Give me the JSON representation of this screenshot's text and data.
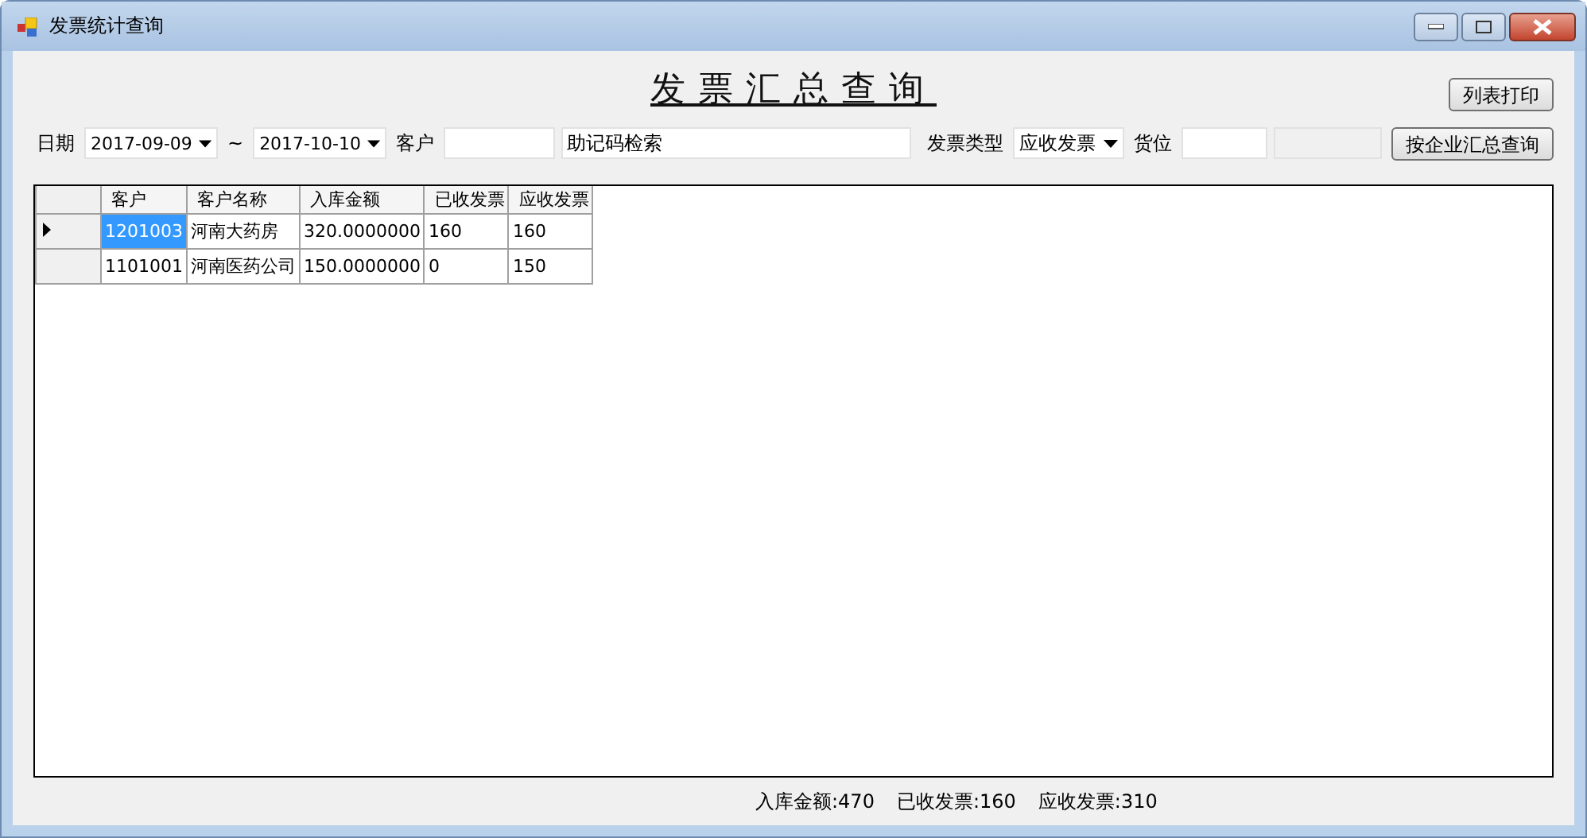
{
  "window": {
    "title": "发票统计查询"
  },
  "heading": "发票汇总查询",
  "print_button": "列表打印",
  "filters": {
    "date_label": "日期",
    "date_from": "2017-09-09",
    "range_sep": "~",
    "date_to": "2017-10-10",
    "customer_label": "客户",
    "mnemonic_search": "助记码检索",
    "invoice_type_label": "发票类型",
    "invoice_type": "应收发票",
    "location_label": "货位",
    "query_button": "按企业汇总查询"
  },
  "table": {
    "columns": [
      "客户",
      "客户名称",
      "入库金额",
      "已收发票",
      "应收发票"
    ],
    "rows": [
      {
        "selected": true,
        "cells": [
          "1201003",
          "河南大药房",
          "320.0000000",
          "160",
          "160"
        ]
      },
      {
        "selected": false,
        "cells": [
          "1101001",
          "河南医药公司",
          "150.0000000",
          "0",
          "150"
        ]
      }
    ]
  },
  "status_bar": [
    "入库金额:470",
    "已收发票:160",
    "应收发票:310"
  ]
}
